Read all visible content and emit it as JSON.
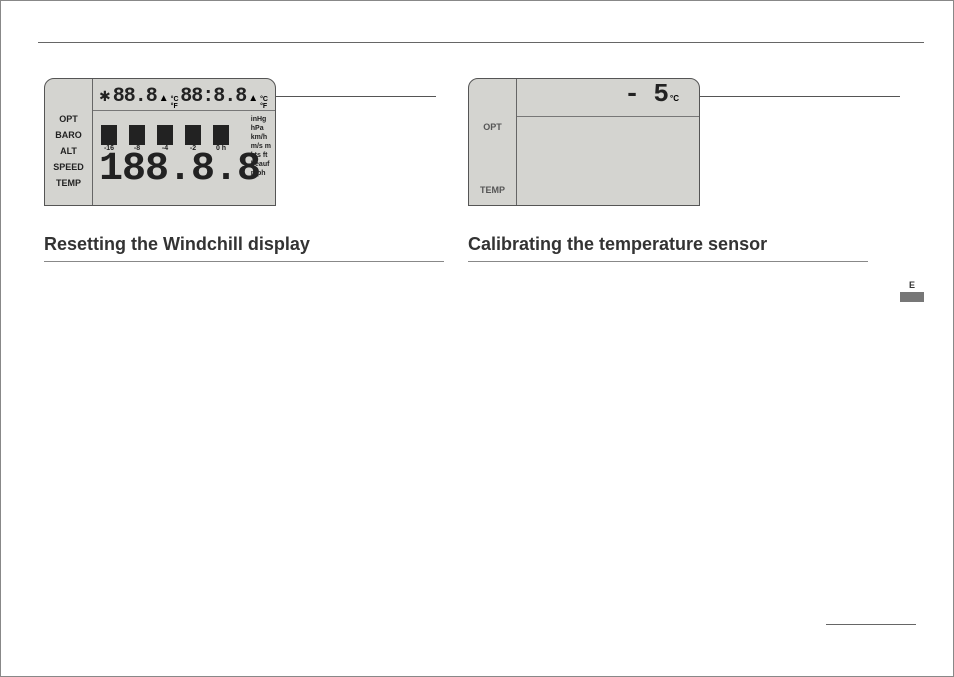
{
  "left": {
    "heading": "Resetting the Windchill display",
    "side_labels": [
      "OPT",
      "BARO",
      "ALT",
      "SPEED",
      "TEMP"
    ],
    "top_seg_a": "88.8",
    "top_seg_b": "88:8.8",
    "cf_label": "°C °F",
    "bar_values": [
      "-16",
      "-8",
      "-4",
      "-2",
      "0 h"
    ],
    "right_units": "inHg\nhPa\nkm/h\nm/s m\nkts ft\nbeauf\nmph",
    "big_value": "188.8.8"
  },
  "right": {
    "heading": "Calibrating the temperature sensor",
    "side_labels": [
      "OPT",
      "TEMP"
    ],
    "value": "- 5",
    "unit": "°C"
  },
  "tab": {
    "label": "E"
  }
}
